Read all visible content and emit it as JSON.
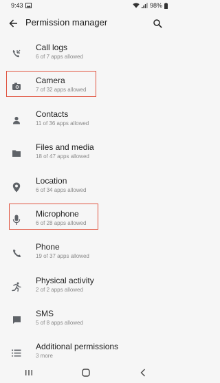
{
  "status_bar": {
    "time": "9:43",
    "battery": "98%"
  },
  "header": {
    "title": "Permission manager"
  },
  "items": [
    {
      "label": "Call logs",
      "sub": "6 of 7 apps allowed",
      "icon": "call-log-icon"
    },
    {
      "label": "Camera",
      "sub": "7 of 32 apps allowed",
      "icon": "camera-icon"
    },
    {
      "label": "Contacts",
      "sub": "11 of 36 apps allowed",
      "icon": "contacts-icon"
    },
    {
      "label": "Files and media",
      "sub": "18 of 47 apps allowed",
      "icon": "folder-icon"
    },
    {
      "label": "Location",
      "sub": "6 of 34 apps allowed",
      "icon": "location-icon"
    },
    {
      "label": "Microphone",
      "sub": "6 of 28 apps allowed",
      "icon": "microphone-icon"
    },
    {
      "label": "Phone",
      "sub": "19 of 37 apps allowed",
      "icon": "phone-icon"
    },
    {
      "label": "Physical activity",
      "sub": "2 of 2 apps allowed",
      "icon": "activity-icon"
    },
    {
      "label": "SMS",
      "sub": "5 of 8 apps allowed",
      "icon": "sms-icon"
    },
    {
      "label": "Additional permissions",
      "sub": "3 more",
      "icon": "list-icon"
    }
  ],
  "colors": {
    "highlight": "#e0533f",
    "icon": "#5f6368"
  }
}
